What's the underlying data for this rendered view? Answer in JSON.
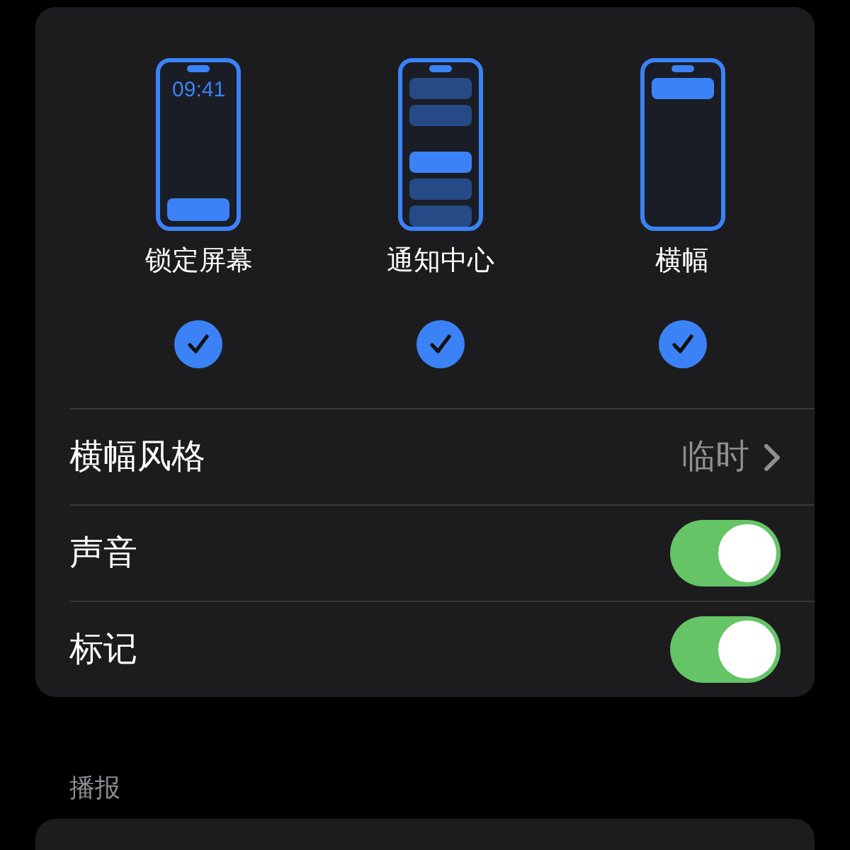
{
  "alert_styles": [
    {
      "kind": "lock_screen",
      "label": "锁定屏幕",
      "time": "09:41",
      "checked": true
    },
    {
      "kind": "notification_center",
      "label": "通知中心",
      "checked": true
    },
    {
      "kind": "banner",
      "label": "横幅",
      "checked": true
    }
  ],
  "rows": [
    {
      "kind": "value",
      "label": "横幅风格",
      "value": "临时"
    },
    {
      "kind": "toggle",
      "label": "声音",
      "on": true
    },
    {
      "kind": "toggle",
      "label": "标记",
      "on": true
    }
  ],
  "section_header": "播报"
}
